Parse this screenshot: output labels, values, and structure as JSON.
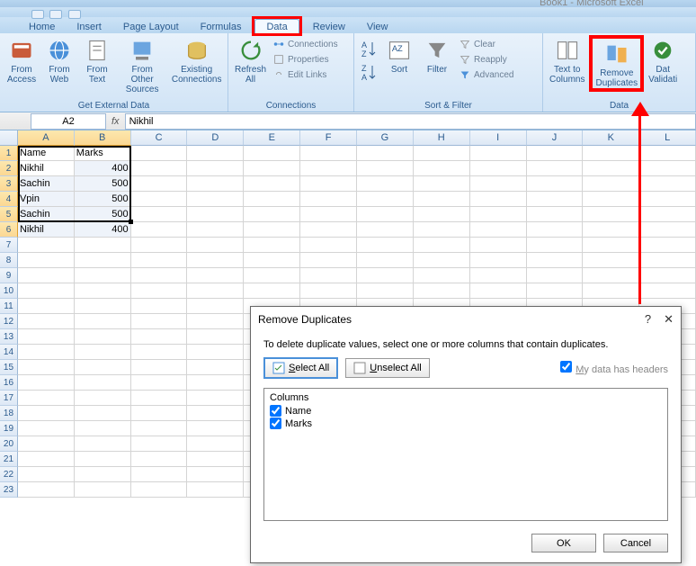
{
  "title": "Book1 - Microsoft Excel",
  "tabs": [
    "Home",
    "Insert",
    "Page Layout",
    "Formulas",
    "Data",
    "Review",
    "View"
  ],
  "active_tab": "Data",
  "ribbon": {
    "external": {
      "label": "Get External Data",
      "access": "From\nAccess",
      "web": "From\nWeb",
      "text": "From\nText",
      "other": "From Other\nSources",
      "existing": "Existing\nConnections"
    },
    "connections": {
      "label": "Connections",
      "refresh": "Refresh\nAll",
      "conn": "Connections",
      "props": "Properties",
      "edit": "Edit Links"
    },
    "sortfilter": {
      "label": "Sort & Filter",
      "sort": "Sort",
      "filter": "Filter",
      "clear": "Clear",
      "reapply": "Reapply",
      "advanced": "Advanced"
    },
    "datatools": {
      "label": "Data",
      "ttc": "Text to\nColumns",
      "rd": "Remove\nDuplicates",
      "val": "Dat\nValidati"
    }
  },
  "namebox": "A2",
  "formula": "Nikhil",
  "cols": [
    "A",
    "B",
    "C",
    "D",
    "E",
    "F",
    "G",
    "H",
    "I",
    "J",
    "K",
    "L"
  ],
  "rows": 23,
  "sheet": [
    {
      "a": "Name",
      "b": "Marks"
    },
    {
      "a": "Nikhil",
      "b": "400"
    },
    {
      "a": "Sachin",
      "b": "500"
    },
    {
      "a": "Vpin",
      "b": "500"
    },
    {
      "a": "Sachin",
      "b": "500"
    },
    {
      "a": "Nikhil",
      "b": "400"
    }
  ],
  "dialog": {
    "title": "Remove Duplicates",
    "desc": "To delete duplicate values, select one or more columns that contain duplicates.",
    "select_all": "Select All",
    "unselect_all": "Unselect All",
    "headers_label": "My data has headers",
    "headers_checked": true,
    "cols_title": "Columns",
    "items": [
      "Name",
      "Marks"
    ],
    "ok": "OK",
    "cancel": "Cancel",
    "help": "?",
    "close": "✕"
  }
}
